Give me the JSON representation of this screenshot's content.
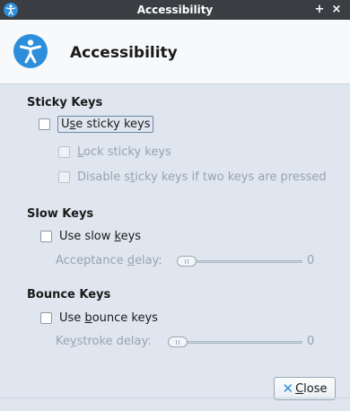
{
  "window": {
    "title": "Accessibility",
    "maximize_glyph": "+",
    "close_glyph": "×",
    "icon": "accessibility-icon"
  },
  "header": {
    "title": "Accessibility",
    "icon": "accessibility-icon"
  },
  "sticky_keys": {
    "heading": "Sticky Keys",
    "use": {
      "label": "Use sticky keys",
      "mnemonic": "s",
      "checked": false,
      "enabled": true
    },
    "lock": {
      "label": "Lock sticky keys",
      "mnemonic": "L",
      "checked": false,
      "enabled": false
    },
    "disable_two": {
      "label": "Disable sticky keys if two keys are pressed",
      "mnemonic": "t",
      "checked": false,
      "enabled": false
    }
  },
  "slow_keys": {
    "heading": "Slow Keys",
    "use": {
      "label": "Use slow keys",
      "mnemonic": "k",
      "checked": false,
      "enabled": true
    },
    "delay": {
      "label": "Acceptance delay:",
      "mnemonic": "d",
      "value": "0",
      "level": 0,
      "enabled": false
    }
  },
  "bounce_keys": {
    "heading": "Bounce Keys",
    "use": {
      "label": "Use bounce keys",
      "mnemonic": "b",
      "checked": false,
      "enabled": true
    },
    "delay": {
      "label": "Keystroke delay:",
      "mnemonic": "y",
      "value": "0",
      "level": 0,
      "enabled": false
    }
  },
  "footer": {
    "close_label": "Close",
    "close_mnemonic": "C",
    "close_icon": "close-x-icon"
  },
  "colors": {
    "accent": "#2d8fdc",
    "titlebar": "#3a3d42",
    "content_bg": "#dfe6ef",
    "disabled_text": "#97a3b0"
  }
}
